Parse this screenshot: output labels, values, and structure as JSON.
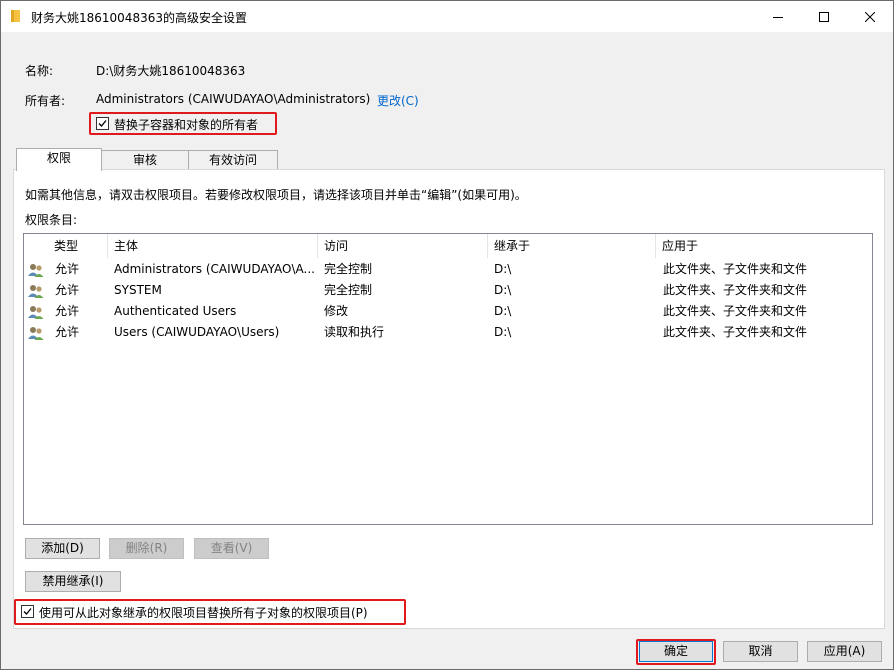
{
  "window": {
    "title": "财务大姚18610048363的高级安全设置"
  },
  "header": {
    "name_label": "名称:",
    "name_value": "D:\\财务大姚18610048363",
    "owner_label": "所有者:",
    "owner_value": "Administrators (CAIWUDAYAO\\Administrators)",
    "change_link": "更改(C)",
    "replace_owner_checkbox": "替换子容器和对象的所有者",
    "replace_owner_checked": true
  },
  "tabs": [
    {
      "label": "权限",
      "active": true
    },
    {
      "label": "审核",
      "active": false
    },
    {
      "label": "有效访问",
      "active": false
    }
  ],
  "permissions": {
    "info_text": "如需其他信息，请双击权限项目。若要修改权限项目，请选择该项目并单击“编辑”(如果可用)。",
    "entries_label": "权限条目:",
    "columns": [
      "类型",
      "主体",
      "访问",
      "继承于",
      "应用于"
    ],
    "rows": [
      {
        "type": "允许",
        "principal": "Administrators (CAIWUDAYAO\\A...",
        "access": "完全控制",
        "inherited": "D:\\",
        "applies": "此文件夹、子文件夹和文件"
      },
      {
        "type": "允许",
        "principal": "SYSTEM",
        "access": "完全控制",
        "inherited": "D:\\",
        "applies": "此文件夹、子文件夹和文件"
      },
      {
        "type": "允许",
        "principal": "Authenticated Users",
        "access": "修改",
        "inherited": "D:\\",
        "applies": "此文件夹、子文件夹和文件"
      },
      {
        "type": "允许",
        "principal": "Users (CAIWUDAYAO\\Users)",
        "access": "读取和执行",
        "inherited": "D:\\",
        "applies": "此文件夹、子文件夹和文件"
      }
    ]
  },
  "buttons": {
    "add": "添加(D)",
    "remove": "删除(R)",
    "view": "查看(V)",
    "disable_inheritance": "禁用继承(I)",
    "ok": "确定",
    "cancel": "取消",
    "apply": "应用(A)"
  },
  "replace_child": {
    "label": "使用可从此对象继承的权限项目替换所有子对象的权限项目(P)",
    "checked": true
  },
  "colors": {
    "highlight_red": "#e0191c",
    "link_blue": "#0066cc"
  }
}
